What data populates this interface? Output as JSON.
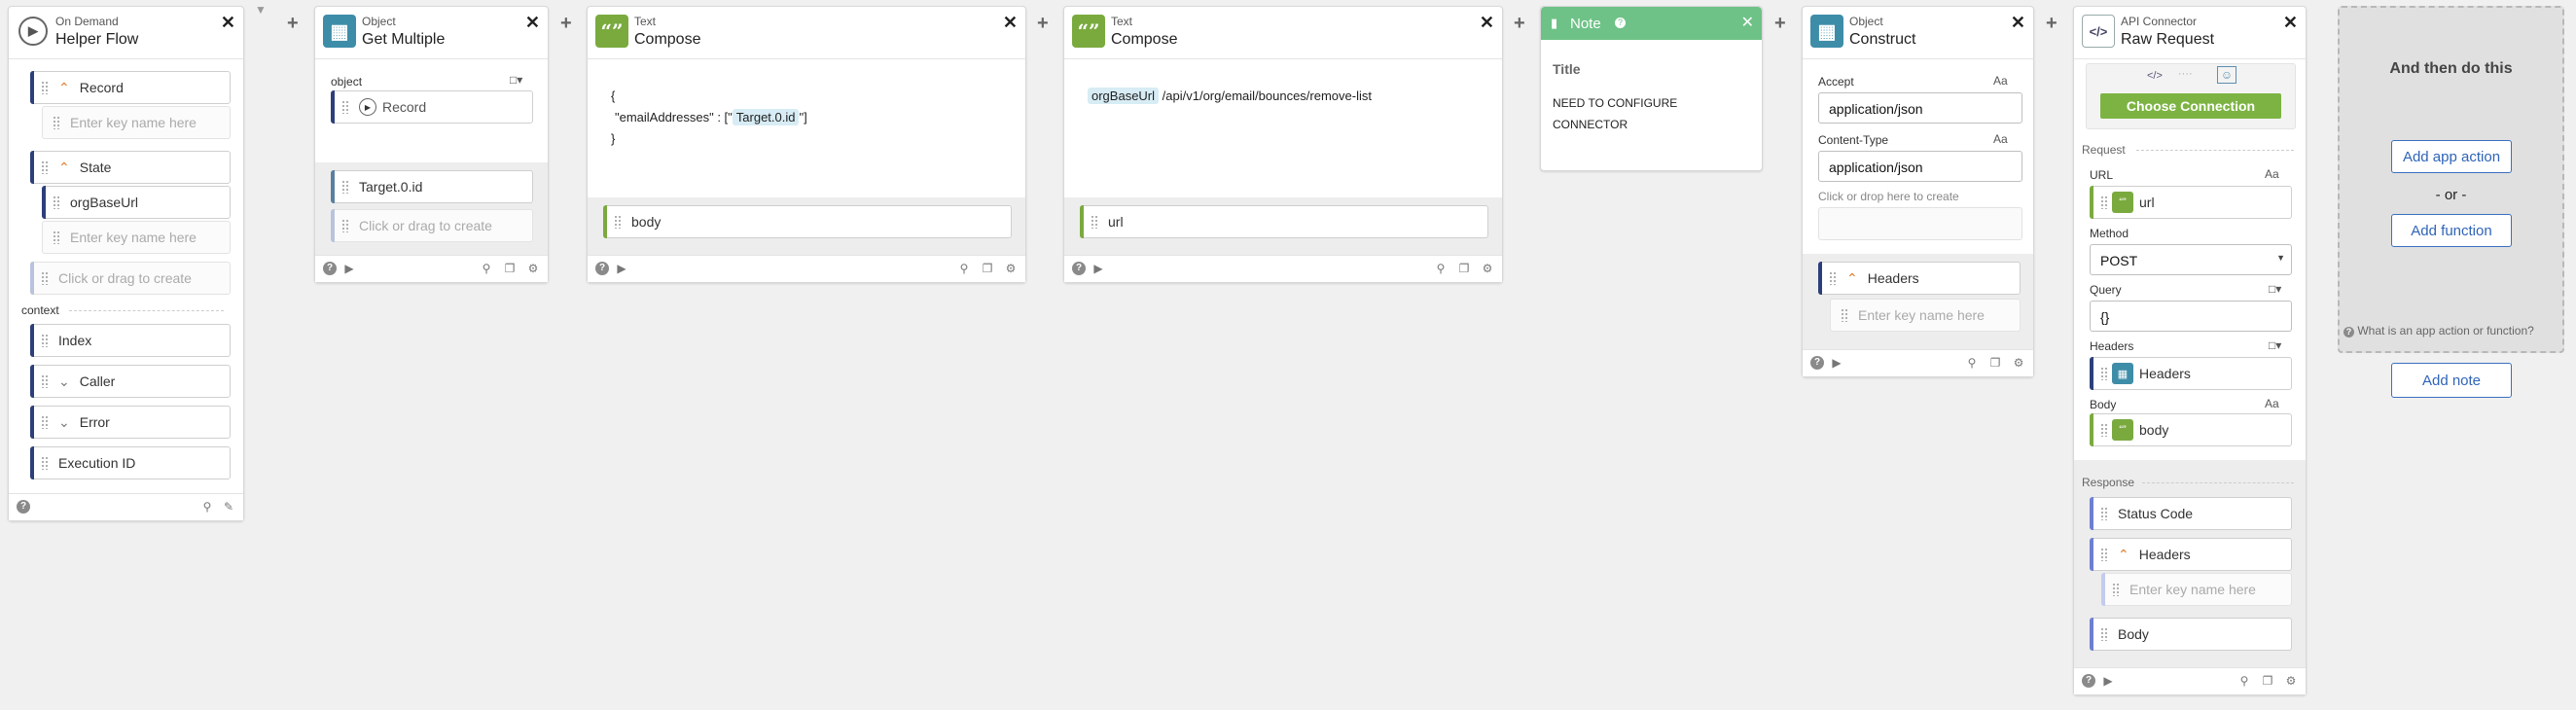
{
  "colors": {
    "object_icon": "#3e8da8",
    "text_icon": "#7aaa3e",
    "note_header": "#6ec287",
    "choose_connection": "#7cb342",
    "link_blue": "#2f64b8"
  },
  "helper_flow": {
    "type": "On Demand",
    "title": "Helper Flow",
    "record": "Record",
    "key_placeholder_1": "Enter key name here",
    "state": "State",
    "org_base_url": "orgBaseUrl",
    "key_placeholder_2": "Enter key name here",
    "click_drag": "Click or drag to create",
    "context_label": "context",
    "index": "Index",
    "caller": "Caller",
    "error": "Error",
    "execution_id": "Execution ID"
  },
  "get_multiple": {
    "type": "Object",
    "title": "Get Multiple",
    "object_label": "object",
    "record": "Record",
    "target": "Target.0.id",
    "click_drag": "Click or drag to create"
  },
  "compose1": {
    "type": "Text",
    "title": "Compose",
    "line1": "{",
    "line2_pre": "\"emailAddresses\" : [\"",
    "line2_chip": "Target.0.id",
    "line2_post": "\"]",
    "line3": "}",
    "output": "body"
  },
  "compose2": {
    "type": "Text",
    "title": "Compose",
    "chip": "orgBaseUrl",
    "path": "/api/v1/org/email/bounces/remove-list",
    "output": "url"
  },
  "note": {
    "header": "Note",
    "title": "Title",
    "body_line1": "NEED TO CONFIGURE",
    "body_line2": "CONNECTOR"
  },
  "construct": {
    "type": "Object",
    "title": "Construct",
    "accept_label": "Accept",
    "accept_value": "application/json",
    "content_type_label": "Content-Type",
    "content_type_value": "application/json",
    "aa": "Aa",
    "drop_hint": "Click or drop here to create",
    "headers": "Headers",
    "key_placeholder": "Enter key name here"
  },
  "api_connector": {
    "type": "API Connector",
    "title": "Raw Request",
    "choose_connection": "Choose Connection",
    "request_label": "Request",
    "url_label": "URL",
    "url_value": "url",
    "method_label": "Method",
    "method_value": "POST",
    "query_label": "Query",
    "query_value": "{}",
    "headers_label": "Headers",
    "headers_value": "Headers",
    "body_label": "Body",
    "body_value": "body",
    "aa": "Aa",
    "response_label": "Response",
    "status_code": "Status Code",
    "resp_headers": "Headers",
    "key_placeholder": "Enter key name here",
    "resp_body": "Body"
  },
  "next_panel": {
    "title": "And then do this",
    "add_app_action": "Add app action",
    "or": "- or -",
    "add_function": "Add function",
    "help_link": "What is an app action or function?",
    "add_note": "Add note"
  }
}
